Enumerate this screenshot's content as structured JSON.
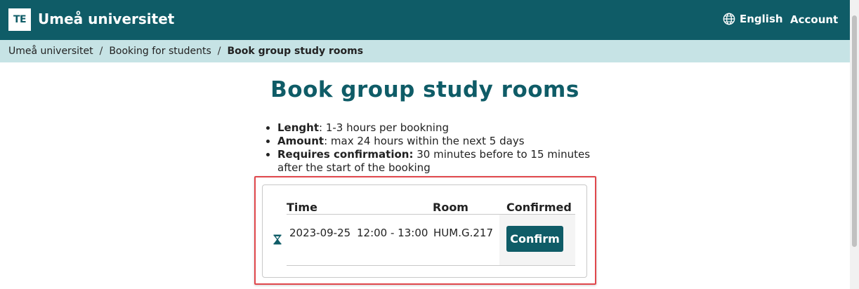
{
  "header": {
    "logo_text": "TE",
    "brand": "Umeå universitet",
    "language": "English",
    "account": "Account"
  },
  "breadcrumb": {
    "items": [
      "Umeå universitet",
      "Booking for students"
    ],
    "separator": "/",
    "current": "Book group study rooms"
  },
  "page": {
    "title": "Book group study rooms"
  },
  "rules": [
    {
      "label": "Lenght",
      "text": ": 1-3 hours per bookning"
    },
    {
      "label": "Amount",
      "text": ": max 24 hours within the next 5 days"
    },
    {
      "label": "Requires confirmation:",
      "text": " 30 minutes before to 15 minutes after the start of the booking"
    }
  ],
  "table": {
    "headers": {
      "time": "Time",
      "room": "Room",
      "confirmed": "Confirmed"
    },
    "rows": [
      {
        "date": "2023-09-25",
        "time": "12:00 - 13:00",
        "room": "HUM.G.217",
        "action": "Confirm",
        "status_icon": "hourglass-icon"
      }
    ]
  },
  "colors": {
    "header_bg": "#0f5c67",
    "breadcrumb_bg": "#c6e3e5",
    "title": "#0f5c67",
    "button_bg": "#0f5c67",
    "highlight_border": "#e0474c"
  }
}
